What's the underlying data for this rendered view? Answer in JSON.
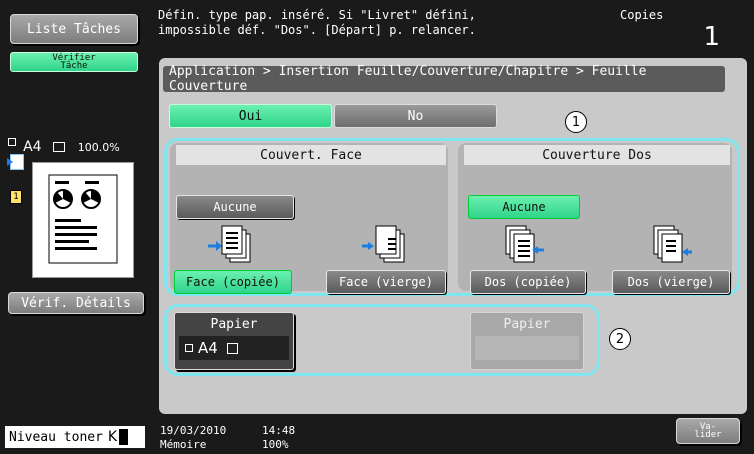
{
  "sidebar": {
    "job_list_button": "Liste Tâches",
    "check_job_button": "Vérifier Tâche",
    "paper_label": "A4",
    "zoom": "100.0%",
    "details_button": "Vérif. Détails",
    "toner_label": "Niveau toner",
    "toner_color": "K"
  },
  "message": {
    "line1": "Défin. type pap. inséré. Si \"Livret\" défini,",
    "line2": "impossible déf. \"Dos\". [Départ] p. relancer.",
    "copies_label": "Copies",
    "copies_value": "1"
  },
  "breadcrumb": "Application > Insertion Feuille/Couverture/Chapitre > Feuille Couverture",
  "toggle": {
    "on_label": "Oui",
    "off_label": "No"
  },
  "front": {
    "title": "Couvert. Face",
    "none_label": "Aucune",
    "copied_label": "Face (copiée)",
    "blank_label": "Face (vierge)"
  },
  "back": {
    "title": "Couverture Dos",
    "none_label": "Aucune",
    "copied_label": "Dos (copiée)",
    "blank_label": "Dos (vierge)"
  },
  "paper": {
    "front_label": "Papier",
    "front_value": "A4",
    "back_label": "Papier"
  },
  "markers": {
    "one": "1",
    "two": "2"
  },
  "status": {
    "date": "19/03/2010",
    "time": "14:48",
    "memory_label": "Mémoire",
    "memory_value": "100%",
    "validate_button": "Va-\nlider"
  },
  "colors": {
    "accent_green": "#2fd48a",
    "highlight_cyan": "#7fe6ee"
  }
}
